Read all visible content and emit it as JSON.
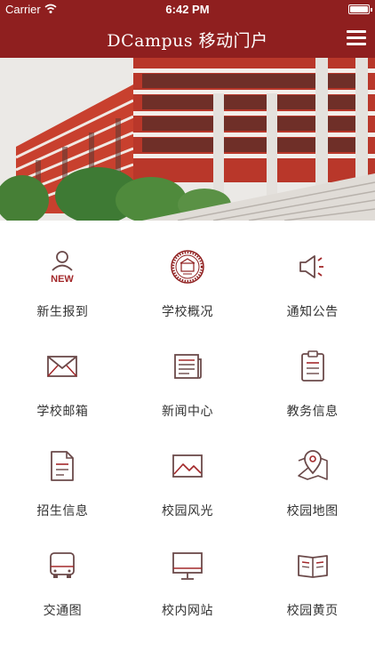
{
  "status_bar": {
    "carrier": "Carrier",
    "time": "6:42 PM"
  },
  "nav": {
    "title": "DCampus 移动门户",
    "menu_icon": "hamburger-menu-icon"
  },
  "banner": {
    "description_icon": "campus-building-photo"
  },
  "colors": {
    "brand": "#8f1f1f",
    "icon_stroke": "#6b4a4a",
    "label_text": "#333333"
  },
  "grid": {
    "items": [
      {
        "label": "新生报到",
        "icon": "new-user-icon",
        "badge": "NEW"
      },
      {
        "label": "学校概况",
        "icon": "school-seal-icon"
      },
      {
        "label": "通知公告",
        "icon": "megaphone-icon"
      },
      {
        "label": "学校邮箱",
        "icon": "mail-icon"
      },
      {
        "label": "新闻中心",
        "icon": "newspaper-icon"
      },
      {
        "label": "教务信息",
        "icon": "clipboard-icon"
      },
      {
        "label": "招生信息",
        "icon": "document-icon"
      },
      {
        "label": "校园风光",
        "icon": "landscape-image-icon"
      },
      {
        "label": "校园地图",
        "icon": "map-pin-icon"
      },
      {
        "label": "交通图",
        "icon": "bus-icon"
      },
      {
        "label": "校内网站",
        "icon": "monitor-icon"
      },
      {
        "label": "校园黄页",
        "icon": "open-book-icon"
      }
    ]
  }
}
